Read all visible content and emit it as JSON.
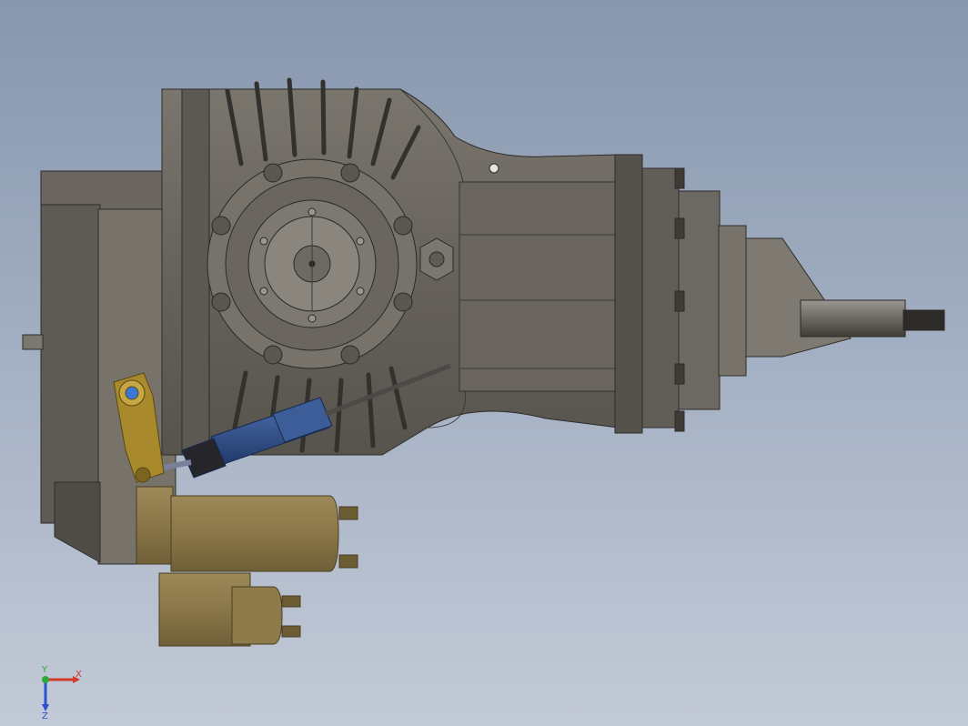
{
  "viewport": {
    "background_top": "#8797ae",
    "background_bottom": "#c3cad7"
  },
  "model": {
    "housing_color": "#6e6a63",
    "housing_dark": "#4a4742",
    "housing_light": "#8d8880",
    "starter_color": "#8c7a4e",
    "starter_light": "#a8956a",
    "actuator_color": "#2f4f86",
    "lever_color": "#a88a2c",
    "icon": "gearbox-assembly"
  },
  "triad": {
    "x_label": "X",
    "y_label": "Y",
    "z_label": "Z",
    "x_color": "#d23a2a",
    "y_color": "#2fa83a",
    "z_color": "#2a4fd2"
  }
}
